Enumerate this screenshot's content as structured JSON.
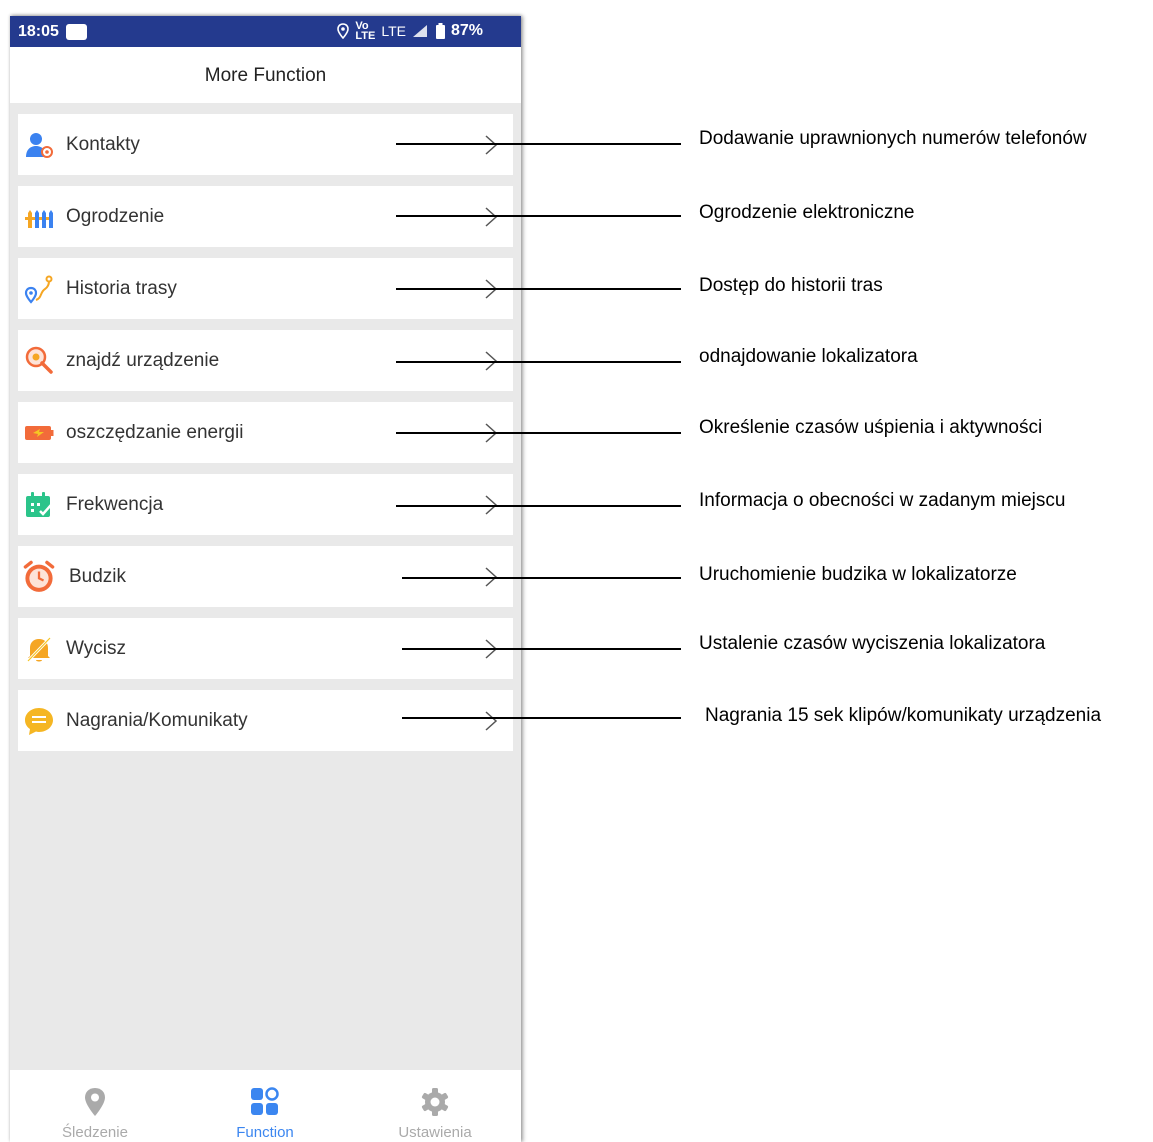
{
  "status_bar": {
    "time": "18:05",
    "network": "LTE",
    "battery": "87%"
  },
  "header": {
    "title": "More Function"
  },
  "menu": {
    "items": [
      {
        "label": "Kontakty",
        "icon": "contacts-icon"
      },
      {
        "label": "Ogrodzenie",
        "icon": "fence-icon"
      },
      {
        "label": "Historia trasy",
        "icon": "route-history-icon"
      },
      {
        "label": "znajdź urządzenie",
        "icon": "find-device-icon"
      },
      {
        "label": "oszczędzanie energii",
        "icon": "battery-saver-icon"
      },
      {
        "label": "Frekwencja",
        "icon": "attendance-calendar-icon"
      },
      {
        "label": "Budzik",
        "icon": "alarm-clock-icon"
      },
      {
        "label": "Wycisz",
        "icon": "mute-bell-icon"
      },
      {
        "label": "Nagrania/Komunikaty",
        "icon": "message-bubble-icon"
      }
    ]
  },
  "bottom_nav": {
    "items": [
      {
        "label": "Śledzenie",
        "icon": "location-pin-icon",
        "active": false
      },
      {
        "label": "Function",
        "icon": "function-grid-icon",
        "active": true
      },
      {
        "label": "Ustawienia",
        "icon": "settings-gear-icon",
        "active": false
      }
    ]
  },
  "annotations": [
    "Dodawanie uprawnionych numerów telefonów",
    "Ogrodzenie elektroniczne",
    "Dostęp do historii tras",
    "odnajdowanie lokalizatora",
    "Określenie czasów uśpienia i aktywności",
    "Informacja o obecności w zadanym miejscu",
    "Uruchomienie budzika w lokalizatorze",
    "Ustalenie czasów wyciszenia lokalizatora",
    "Nagrania 15 sek klipów/komunikaty urządzenia"
  ],
  "colors": {
    "status_bar": "#243a8e",
    "active_nav": "#3b86f0",
    "inactive_nav": "#aaaaaa",
    "background": "#e9e9e9"
  }
}
